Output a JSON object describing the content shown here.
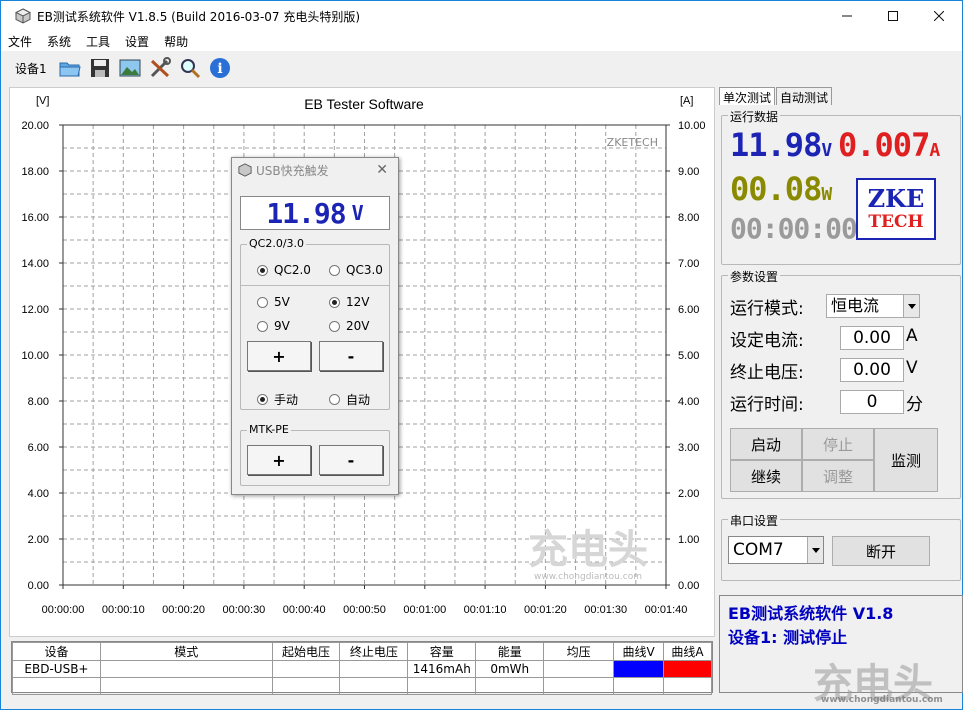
{
  "window": {
    "title": "EB测试系统软件 V1.8.5 (Build 2016-03-07 充电头特别版)"
  },
  "menu": [
    "文件",
    "系统",
    "工具",
    "设置",
    "帮助"
  ],
  "toolbar": {
    "device_label": "设备1",
    "icons": [
      "open-folder-icon",
      "save-icon",
      "image-icon",
      "tools-icon",
      "search-icon",
      "info-icon"
    ]
  },
  "chart": {
    "title": "EB Tester Software",
    "left_unit": "[V]",
    "right_unit": "[A]",
    "watermark": "ZKETECH",
    "site_watermark": "充电头",
    "site_url": "www.chongdiantou.com"
  },
  "chart_data": {
    "type": "line",
    "title": "EB Tester Software",
    "ylabel": "[V]",
    "y2label": "[A]",
    "ylim": [
      0,
      20
    ],
    "y2lim": [
      0,
      10
    ],
    "yticks": [
      "0.00",
      "2.00",
      "4.00",
      "6.00",
      "8.00",
      "10.00",
      "12.00",
      "14.00",
      "16.00",
      "18.00",
      "20.00"
    ],
    "y2ticks": [
      "0.00",
      "1.00",
      "2.00",
      "3.00",
      "4.00",
      "5.00",
      "6.00",
      "7.00",
      "8.00",
      "9.00",
      "10.00"
    ],
    "xticks": [
      "00:00:00",
      "00:00:10",
      "00:00:20",
      "00:00:30",
      "00:00:40",
      "00:00:50",
      "00:01:00",
      "00:01:10",
      "00:01:20",
      "00:01:30",
      "00:01:40"
    ],
    "grid": true,
    "series": []
  },
  "table": {
    "headers": [
      "设备",
      "模式",
      "起始电压",
      "终止电压",
      "容量",
      "能量",
      "均压",
      "曲线V",
      "曲线A"
    ],
    "rows": [
      [
        "EBD-USB+",
        "",
        "",
        "",
        "1416mAh",
        "0mWh",
        "",
        "",
        ""
      ]
    ],
    "curve_colors": {
      "v": "#0000ff",
      "a": "#ff0000"
    }
  },
  "tabs": [
    "单次测试",
    "自动测试"
  ],
  "run_data": {
    "label": "运行数据",
    "voltage": "11.98",
    "voltage_unit": "V",
    "current": "0.007",
    "current_unit": "A",
    "power": "00.08",
    "power_unit": "W",
    "time": "00:00:00",
    "logo_top": "ZKE",
    "logo_bottom": "TECH",
    "colors": {
      "voltage": "#1c24b4",
      "current": "#e02020",
      "power": "#8a8a00",
      "time": "#9a9a9a"
    }
  },
  "params": {
    "label": "参数设置",
    "mode_label": "运行模式:",
    "mode_value": "恒电流",
    "current_label": "设定电流:",
    "current_value": "0.00",
    "current_unit": "A",
    "cutoff_label": "终止电压:",
    "cutoff_value": "0.00",
    "cutoff_unit": "V",
    "time_label": "运行时间:",
    "time_value": "0",
    "time_unit": "分",
    "buttons": {
      "start": "启动",
      "stop": "停止",
      "monitor": "监测",
      "continue": "继续",
      "adjust": "调整"
    }
  },
  "serial": {
    "label": "串口设置",
    "port": "COM7",
    "disconnect": "断开"
  },
  "status": {
    "line1": "EB测试系统软件 V1.8",
    "line2": "设备1: 测试停止"
  },
  "dialog": {
    "title": "USB快充触发",
    "voltage": "11.98",
    "voltage_unit": "V",
    "qc_group": "QC2.0/3.0",
    "qc20": "QC2.0",
    "qc30": "QC3.0",
    "v5": "5V",
    "v12": "12V",
    "v9": "9V",
    "v20": "20V",
    "plus": "+",
    "minus": "-",
    "manual": "手动",
    "auto": "自动",
    "mtk_group": "MTK-PE"
  },
  "bottom_watermark": "充电头",
  "bottom_url": "www.chongdiantou.com"
}
